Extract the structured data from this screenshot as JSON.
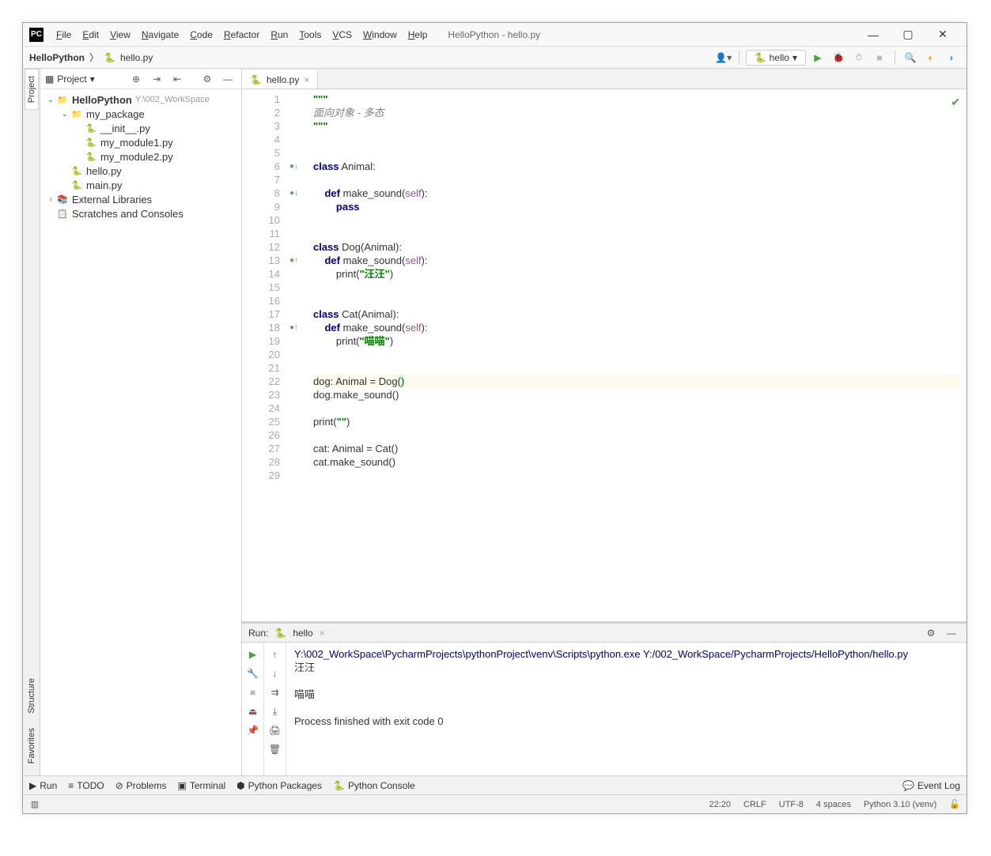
{
  "window": {
    "title": "HelloPython - hello.py",
    "menu": [
      "File",
      "Edit",
      "View",
      "Navigate",
      "Code",
      "Refactor",
      "Run",
      "Tools",
      "VCS",
      "Window",
      "Help"
    ]
  },
  "breadcrumb": {
    "project": "HelloPython",
    "file": "hello.py"
  },
  "run_config": {
    "name": "hello"
  },
  "left_tabs": {
    "project": "Project",
    "structure": "Structure",
    "favorites": "Favorites"
  },
  "panel": {
    "title": "Project",
    "toolbar_icons": [
      "target-icon",
      "expand-icon",
      "collapse-icon",
      "gear-icon",
      "hide-icon"
    ]
  },
  "tree": [
    {
      "depth": 0,
      "caret": "v",
      "icon": "folder",
      "bold": true,
      "label": "HelloPython",
      "path": "Y:\\002_WorkSpace"
    },
    {
      "depth": 1,
      "caret": "v",
      "icon": "folder",
      "label": "my_package"
    },
    {
      "depth": 2,
      "caret": "",
      "icon": "py",
      "label": "__init__.py"
    },
    {
      "depth": 2,
      "caret": "",
      "icon": "py",
      "label": "my_module1.py"
    },
    {
      "depth": 2,
      "caret": "",
      "icon": "py",
      "label": "my_module2.py"
    },
    {
      "depth": 1,
      "caret": "",
      "icon": "py",
      "label": "hello.py"
    },
    {
      "depth": 1,
      "caret": "",
      "icon": "py",
      "label": "main.py"
    },
    {
      "depth": 0,
      "caret": ">",
      "icon": "lib",
      "label": "External Libraries"
    },
    {
      "depth": 0,
      "caret": "",
      "icon": "scratch",
      "label": "Scratches and Consoles"
    }
  ],
  "editor": {
    "tab": "hello.py",
    "highlight_line": 22,
    "lines": [
      {
        "n": 1,
        "html": "<span class='str'>\"\"\"</span>"
      },
      {
        "n": 2,
        "html": "<span class='com'>面向对象 - 多态</span>"
      },
      {
        "n": 3,
        "html": "<span class='str'>\"\"\"</span>"
      },
      {
        "n": 4,
        "html": ""
      },
      {
        "n": 5,
        "html": ""
      },
      {
        "n": 6,
        "mark": "●↓",
        "html": "<span class='kw'>class</span> Animal:"
      },
      {
        "n": 7,
        "html": ""
      },
      {
        "n": 8,
        "mark": "●↓",
        "html": "    <span class='kw'>def</span> make_sound(<span class='self'>self</span>):"
      },
      {
        "n": 9,
        "html": "        <span class='kw'>pass</span>"
      },
      {
        "n": 10,
        "html": ""
      },
      {
        "n": 11,
        "html": ""
      },
      {
        "n": 12,
        "html": "<span class='kw'>class</span> Dog(Animal):"
      },
      {
        "n": 13,
        "mark": "●↑",
        "html": "    <span class='kw'>def</span> make_sound(<span class='self'>self</span>):"
      },
      {
        "n": 14,
        "html": "        print(<span class='str'>\"汪汪\"</span>)"
      },
      {
        "n": 15,
        "html": ""
      },
      {
        "n": 16,
        "html": ""
      },
      {
        "n": 17,
        "html": "<span class='kw'>class</span> Cat(Animal):"
      },
      {
        "n": 18,
        "mark": "●↑",
        "html": "    <span class='kw'>def</span> make_sound(<span class='self'>self</span>):"
      },
      {
        "n": 19,
        "html": "        print(<span class='str'>\"喵喵\"</span>)"
      },
      {
        "n": 20,
        "html": ""
      },
      {
        "n": 21,
        "html": ""
      },
      {
        "n": 22,
        "html": "dog: Animal = Dog<span class='paren-hl'>()</span>"
      },
      {
        "n": 23,
        "html": "dog.make_sound()"
      },
      {
        "n": 24,
        "html": ""
      },
      {
        "n": 25,
        "html": "print(<span class='str'>\"\"</span>)"
      },
      {
        "n": 26,
        "html": ""
      },
      {
        "n": 27,
        "html": "cat: Animal = Cat()"
      },
      {
        "n": 28,
        "html": "cat.make_sound()"
      },
      {
        "n": 29,
        "html": ""
      }
    ]
  },
  "run_panel": {
    "label": "Run:",
    "config": "hello",
    "command": "Y:\\002_WorkSpace\\PycharmProjects\\pythonProject\\venv\\Scripts\\python.exe Y:/002_WorkSpace/PycharmProjects/HelloPython/hello.py",
    "output": [
      "汪汪",
      "",
      "喵喵",
      "",
      "Process finished with exit code 0"
    ]
  },
  "bottom_tabs": {
    "run": "Run",
    "todo": "TODO",
    "problems": "Problems",
    "terminal": "Terminal",
    "packages": "Python Packages",
    "console": "Python Console",
    "event_log": "Event Log"
  },
  "status": {
    "cursor": "22:20",
    "sep": "CRLF",
    "enc": "UTF-8",
    "indent": "4 spaces",
    "python": "Python 3.10 (venv)"
  }
}
